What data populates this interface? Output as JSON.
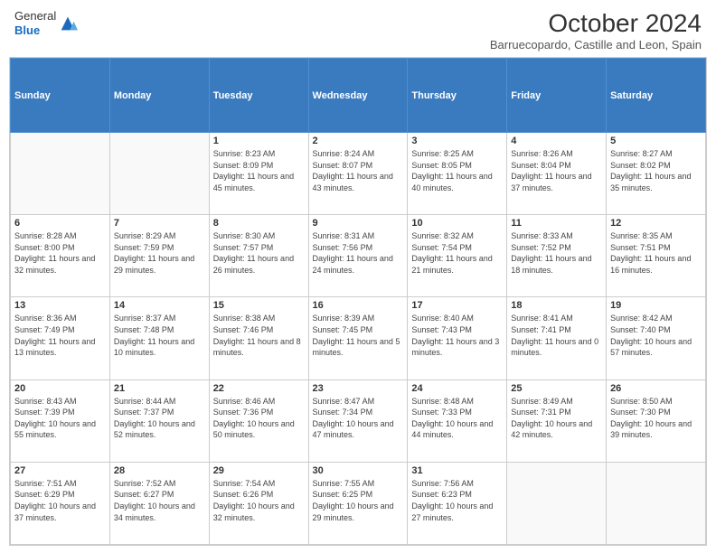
{
  "header": {
    "logo_general": "General",
    "logo_blue": "Blue",
    "month_title": "October 2024",
    "subtitle": "Barruecopardo, Castille and Leon, Spain"
  },
  "weekdays": [
    "Sunday",
    "Monday",
    "Tuesday",
    "Wednesday",
    "Thursday",
    "Friday",
    "Saturday"
  ],
  "weeks": [
    [
      {
        "day": "",
        "info": ""
      },
      {
        "day": "",
        "info": ""
      },
      {
        "day": "1",
        "info": "Sunrise: 8:23 AM\nSunset: 8:09 PM\nDaylight: 11 hours and 45 minutes."
      },
      {
        "day": "2",
        "info": "Sunrise: 8:24 AM\nSunset: 8:07 PM\nDaylight: 11 hours and 43 minutes."
      },
      {
        "day": "3",
        "info": "Sunrise: 8:25 AM\nSunset: 8:05 PM\nDaylight: 11 hours and 40 minutes."
      },
      {
        "day": "4",
        "info": "Sunrise: 8:26 AM\nSunset: 8:04 PM\nDaylight: 11 hours and 37 minutes."
      },
      {
        "day": "5",
        "info": "Sunrise: 8:27 AM\nSunset: 8:02 PM\nDaylight: 11 hours and 35 minutes."
      }
    ],
    [
      {
        "day": "6",
        "info": "Sunrise: 8:28 AM\nSunset: 8:00 PM\nDaylight: 11 hours and 32 minutes."
      },
      {
        "day": "7",
        "info": "Sunrise: 8:29 AM\nSunset: 7:59 PM\nDaylight: 11 hours and 29 minutes."
      },
      {
        "day": "8",
        "info": "Sunrise: 8:30 AM\nSunset: 7:57 PM\nDaylight: 11 hours and 26 minutes."
      },
      {
        "day": "9",
        "info": "Sunrise: 8:31 AM\nSunset: 7:56 PM\nDaylight: 11 hours and 24 minutes."
      },
      {
        "day": "10",
        "info": "Sunrise: 8:32 AM\nSunset: 7:54 PM\nDaylight: 11 hours and 21 minutes."
      },
      {
        "day": "11",
        "info": "Sunrise: 8:33 AM\nSunset: 7:52 PM\nDaylight: 11 hours and 18 minutes."
      },
      {
        "day": "12",
        "info": "Sunrise: 8:35 AM\nSunset: 7:51 PM\nDaylight: 11 hours and 16 minutes."
      }
    ],
    [
      {
        "day": "13",
        "info": "Sunrise: 8:36 AM\nSunset: 7:49 PM\nDaylight: 11 hours and 13 minutes."
      },
      {
        "day": "14",
        "info": "Sunrise: 8:37 AM\nSunset: 7:48 PM\nDaylight: 11 hours and 10 minutes."
      },
      {
        "day": "15",
        "info": "Sunrise: 8:38 AM\nSunset: 7:46 PM\nDaylight: 11 hours and 8 minutes."
      },
      {
        "day": "16",
        "info": "Sunrise: 8:39 AM\nSunset: 7:45 PM\nDaylight: 11 hours and 5 minutes."
      },
      {
        "day": "17",
        "info": "Sunrise: 8:40 AM\nSunset: 7:43 PM\nDaylight: 11 hours and 3 minutes."
      },
      {
        "day": "18",
        "info": "Sunrise: 8:41 AM\nSunset: 7:41 PM\nDaylight: 11 hours and 0 minutes."
      },
      {
        "day": "19",
        "info": "Sunrise: 8:42 AM\nSunset: 7:40 PM\nDaylight: 10 hours and 57 minutes."
      }
    ],
    [
      {
        "day": "20",
        "info": "Sunrise: 8:43 AM\nSunset: 7:39 PM\nDaylight: 10 hours and 55 minutes."
      },
      {
        "day": "21",
        "info": "Sunrise: 8:44 AM\nSunset: 7:37 PM\nDaylight: 10 hours and 52 minutes."
      },
      {
        "day": "22",
        "info": "Sunrise: 8:46 AM\nSunset: 7:36 PM\nDaylight: 10 hours and 50 minutes."
      },
      {
        "day": "23",
        "info": "Sunrise: 8:47 AM\nSunset: 7:34 PM\nDaylight: 10 hours and 47 minutes."
      },
      {
        "day": "24",
        "info": "Sunrise: 8:48 AM\nSunset: 7:33 PM\nDaylight: 10 hours and 44 minutes."
      },
      {
        "day": "25",
        "info": "Sunrise: 8:49 AM\nSunset: 7:31 PM\nDaylight: 10 hours and 42 minutes."
      },
      {
        "day": "26",
        "info": "Sunrise: 8:50 AM\nSunset: 7:30 PM\nDaylight: 10 hours and 39 minutes."
      }
    ],
    [
      {
        "day": "27",
        "info": "Sunrise: 7:51 AM\nSunset: 6:29 PM\nDaylight: 10 hours and 37 minutes."
      },
      {
        "day": "28",
        "info": "Sunrise: 7:52 AM\nSunset: 6:27 PM\nDaylight: 10 hours and 34 minutes."
      },
      {
        "day": "29",
        "info": "Sunrise: 7:54 AM\nSunset: 6:26 PM\nDaylight: 10 hours and 32 minutes."
      },
      {
        "day": "30",
        "info": "Sunrise: 7:55 AM\nSunset: 6:25 PM\nDaylight: 10 hours and 29 minutes."
      },
      {
        "day": "31",
        "info": "Sunrise: 7:56 AM\nSunset: 6:23 PM\nDaylight: 10 hours and 27 minutes."
      },
      {
        "day": "",
        "info": ""
      },
      {
        "day": "",
        "info": ""
      }
    ]
  ]
}
